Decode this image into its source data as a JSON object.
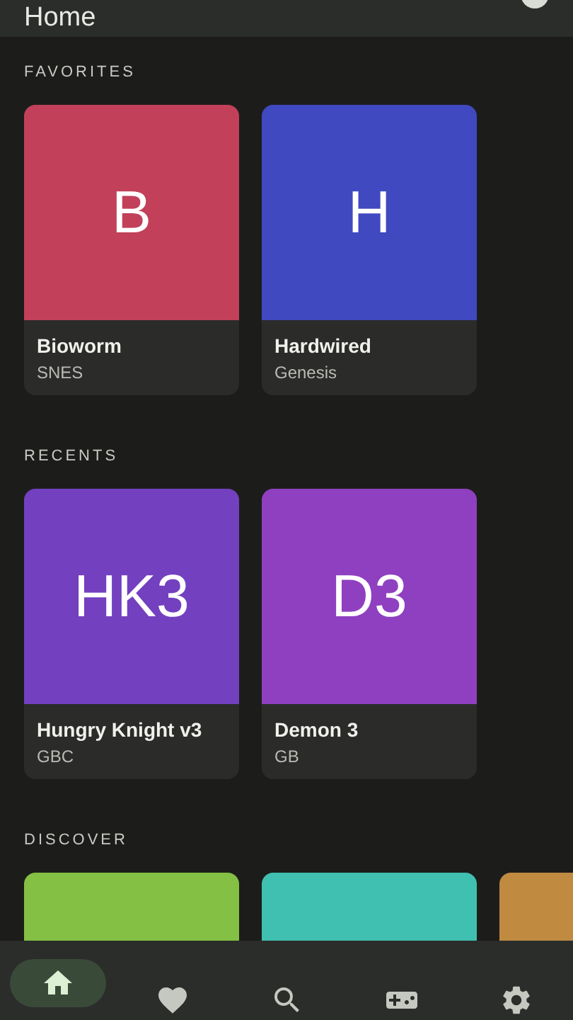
{
  "app_bar": {
    "title": "Home"
  },
  "sections": [
    {
      "title": "FAVORITES",
      "cards": [
        {
          "initials": "B",
          "title": "Bioworm",
          "platform": "SNES",
          "color": "#c2405a"
        },
        {
          "initials": "H",
          "title": "Hardwired",
          "platform": "Genesis",
          "color": "#4049c0"
        }
      ]
    },
    {
      "title": "RECENTS",
      "cards": [
        {
          "initials": "HK3",
          "title": "Hungry Knight v3",
          "platform": "GBC",
          "color": "#7340c0"
        },
        {
          "initials": "D3",
          "title": "Demon 3",
          "platform": "GB",
          "color": "#8f40c0"
        }
      ]
    },
    {
      "title": "DISCOVER",
      "cards": [
        {
          "color": "#84c043"
        },
        {
          "color": "#40c0b0"
        },
        {
          "color": "#c08b40"
        }
      ]
    }
  ],
  "nav": [
    {
      "selected": true
    },
    {
      "selected": false
    },
    {
      "selected": false
    },
    {
      "selected": false
    },
    {
      "selected": false
    }
  ]
}
